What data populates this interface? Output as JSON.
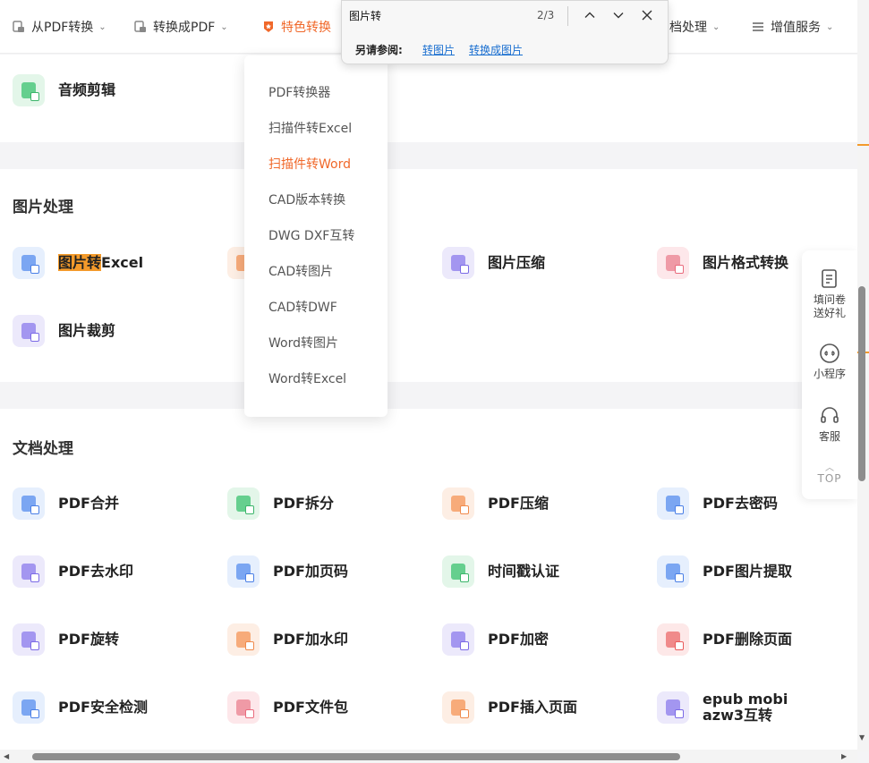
{
  "nav": {
    "items": [
      "从PDF转换",
      "转换成PDF",
      "特色转换",
      "档处理",
      "增值服务"
    ]
  },
  "find": {
    "query": "图片转",
    "count": "2/3",
    "see_also_label": "另请参阅:",
    "links": [
      "转图片",
      "转换成图片"
    ],
    "up_icon": "chevron-up-icon",
    "down_icon": "chevron-down-icon",
    "close_icon": "close-icon"
  },
  "dropdown": {
    "items": [
      "PDF转换器",
      "扫描件转Excel",
      "扫描件转Word",
      "CAD版本转换",
      "DWG DXF互转",
      "CAD转图片",
      "CAD转DWF",
      "Word转图片",
      "Word转Excel"
    ]
  },
  "audio": {
    "label": "音频剪辑"
  },
  "image_section": {
    "title": "图片处理",
    "tool1_hl": "图片转",
    "tool1_rest": "Excel",
    "tools": [
      "图片压缩",
      "图片格式转换",
      "图片裁剪"
    ]
  },
  "doc_section": {
    "title": "文档处理",
    "tools": [
      "PDF合并",
      "PDF拆分",
      "PDF压缩",
      "PDF去密码",
      "PDF去水印",
      "PDF加页码",
      "时间戳认证",
      "PDF图片提取",
      "PDF旋转",
      "PDF加水印",
      "PDF加密",
      "PDF删除页面",
      "PDF安全检测",
      "PDF文件包",
      "PDF插入页面",
      "epub mobi",
      "azw3互转"
    ]
  },
  "right_panel": {
    "survey_line1": "填问卷",
    "survey_line2": "送好礼",
    "mini": "小程序",
    "service": "客服",
    "top": "TOP"
  },
  "colors": {
    "accent": "#f0682a",
    "highlight": "#f39a2b",
    "link": "#1a6fd0"
  }
}
